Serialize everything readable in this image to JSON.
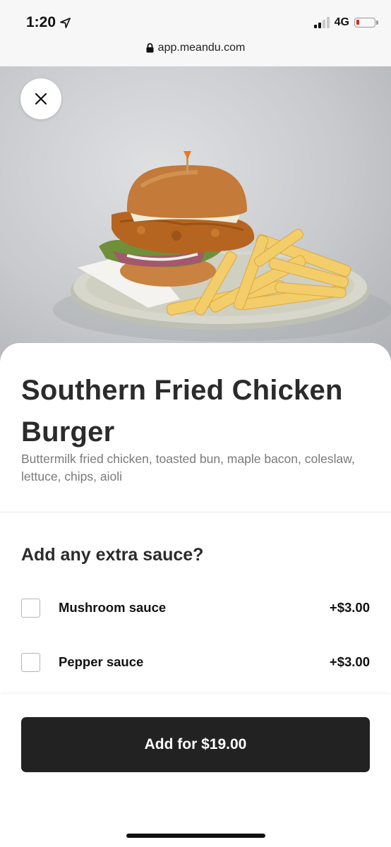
{
  "status_bar": {
    "time": "1:20",
    "location_icon": "location-arrow-icon",
    "network": "4G",
    "signal_icon": "signal-bars-icon",
    "battery_icon": "battery-low-icon",
    "battery_color": "#e32424"
  },
  "browser": {
    "url": "app.meandu.com",
    "lock_icon": "lock-icon"
  },
  "hero": {
    "image_icon": "food-photo-burger-and-fries",
    "close_icon": "close-icon"
  },
  "item": {
    "title": "Southern Fried Chicken Burger",
    "description": "Buttermilk fried chicken, toasted bun, maple bacon, coleslaw, lettuce, chips, aioli"
  },
  "extras": {
    "heading": "Add any extra sauce?",
    "options": [
      {
        "label": "Mushroom sauce",
        "price": "+$3.00",
        "checked": false
      },
      {
        "label": "Pepper sauce",
        "price": "+$3.00",
        "checked": false
      }
    ]
  },
  "footer": {
    "add_label": "Add for $19.00",
    "button_color": "#222222"
  }
}
